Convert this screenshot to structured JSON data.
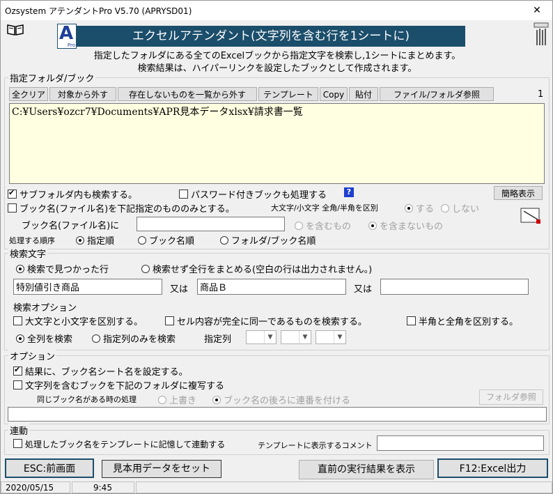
{
  "window": {
    "title": "Ozsystem アテンダントPro V5.70 (APRYSD01)",
    "close_glyph": "✕"
  },
  "header": {
    "banner": "エクセルアテンダント(文字列を含む行を1シートに)",
    "logo_letter": "A",
    "logo_sub": "Pro",
    "desc1": "指定したフォルダにある全てのExcelブックから指定文字を検索し,1シートにまとめます。",
    "desc2": "検索結果は、ハイパーリンクを設定したブックとして作成されます。"
  },
  "folder_group": {
    "label": "指定フォルダ/ブック",
    "buttons": {
      "clear_all": "全クリア",
      "remove_target": "対象から外す",
      "remove_missing": "存在しないものを一覧から外す",
      "template": "テンプレート",
      "copy": "Copy",
      "paste": "貼付",
      "browse": "ファイル/フォルダ参照"
    },
    "count": "1",
    "path_list": "C:¥Users¥ozcr7¥Documents¥APR見本データxlsx¥請求書一覧",
    "include_subfolders": "サブフォルダ内も検索する。",
    "process_password": "パスワード付きブックも処理する",
    "help_glyph": "?",
    "brief_button": "簡略表示",
    "bookname_only": "ブック名(ファイル名)を下記指定のもののみとする。",
    "case_label": "大文字/小文字 全角/半角を区別",
    "case_yes": "する",
    "case_no": "しない",
    "bookname_label": "ブック名(ファイル名)に",
    "bookname_value": "",
    "contains": "を含むもの",
    "not_contains": "を含まないもの",
    "order_label": "処理する順序",
    "order_specified": "指定順",
    "order_book": "ブック名順",
    "order_folder": "フォルダ/ブック名順"
  },
  "search_group": {
    "label": "検索文字",
    "found_rows": "検索で見つかった行",
    "all_rows": "検索せず全行をまとめる(空白の行は出力されません。)",
    "term1": "特別値引き商品",
    "or1": "又は",
    "term2": "商品Ｂ",
    "or2": "又は",
    "term3": "",
    "options_label": "検索オプション",
    "opt_case": "大文字と小文字を区別する。",
    "opt_exact": "セル内容が完全に同一であるものを検索する。",
    "opt_width": "半角と全角を区別する。",
    "all_columns": "全列を検索",
    "specified_columns": "指定列のみを検索",
    "columns_label": "指定列",
    "col1": "",
    "col2": "",
    "col3": ""
  },
  "options_group": {
    "label": "オプション",
    "set_sheet_name": "結果に、ブック名シート名を設定する。",
    "copy_books": "文字列を含むブックを下記のフォルダに複写する",
    "dup_label": "同じブック名がある時の処理",
    "overwrite": "上書き",
    "append_number": "ブック名の後ろに連番を付ける",
    "folder_browse": "フォルダ参照",
    "folder_path": ""
  },
  "link_group": {
    "label": "連動",
    "remember": "処理したブック名をテンプレートに記憶して連動する",
    "comment_label": "テンプレートに表示するコメント",
    "comment_value": ""
  },
  "footer": {
    "esc": "ESC:前画面",
    "sample": "見本用データをセット",
    "show_last": "直前の実行結果を表示",
    "excel_out": "F12:Excel出力"
  },
  "statusbar": {
    "date": "2020/05/15",
    "time": "9:45"
  },
  "icons": {
    "book": "book-icon",
    "clip": "paperclip-icon",
    "edit": "edit-icon"
  }
}
